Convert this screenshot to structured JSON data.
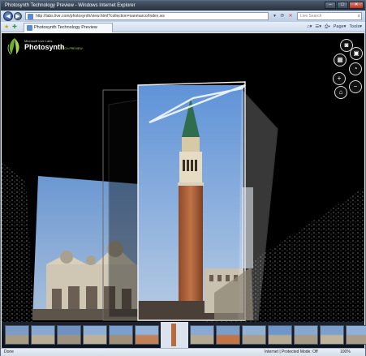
{
  "window": {
    "title": "Photosynth Technology Preview - Windows Internet Explorer"
  },
  "address_bar": {
    "url": "http://labs.live.com/photosynth/view.html?collection=sanmarco/Index.ws",
    "search_placeholder": "Live Search",
    "icons": [
      "back-icon",
      "forward-icon",
      "refresh-icon",
      "close-icon",
      "search-icon"
    ]
  },
  "tab_bar": {
    "tab_label": "Photosynth Technology Preview",
    "tools": {
      "page_label": "Page",
      "tools_label": "Tools"
    }
  },
  "viewer": {
    "logo": {
      "brand_small": "Microsoft Live Labs",
      "brand": "Photosynth",
      "tagline": "TECH PREVIEW"
    },
    "controls": [
      "camera-icon",
      "photo-icon",
      "grid-icon",
      "zoom-icon",
      "plus-icon",
      "minus-icon",
      "home-icon"
    ],
    "thumbnail_count": 14,
    "selected_thumbnail": 6
  },
  "status_bar": {
    "left": "Done",
    "zone": "Internet | Protected Mode: Off",
    "zoom": "100%"
  },
  "colors": {
    "accent": "#27313f",
    "sky": "#7ea8df",
    "tower": "#b86a3d"
  }
}
